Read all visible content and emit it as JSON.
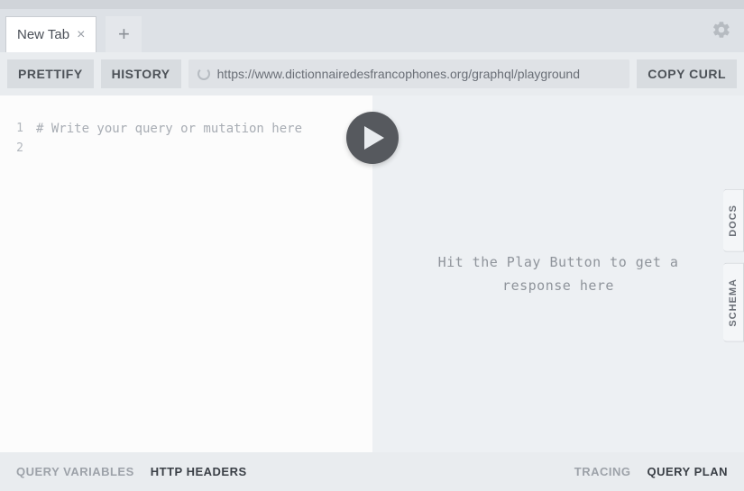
{
  "tabs": {
    "active": {
      "label": "New Tab"
    }
  },
  "toolbar": {
    "prettify": "PRETTIFY",
    "history": "HISTORY",
    "copy_curl": "COPY CURL",
    "url": "https://www.dictionnairedesfrancophones.org/graphql/playground"
  },
  "editor": {
    "lines": [
      "1",
      "2"
    ],
    "placeholder": "# Write your query or mutation here"
  },
  "response": {
    "placeholder": "Hit the Play Button to get a response here"
  },
  "side": {
    "docs": "DOCS",
    "schema": "SCHEMA"
  },
  "bottom": {
    "query_variables": "QUERY VARIABLES",
    "http_headers": "HTTP HEADERS",
    "tracing": "TRACING",
    "query_plan": "QUERY PLAN"
  }
}
